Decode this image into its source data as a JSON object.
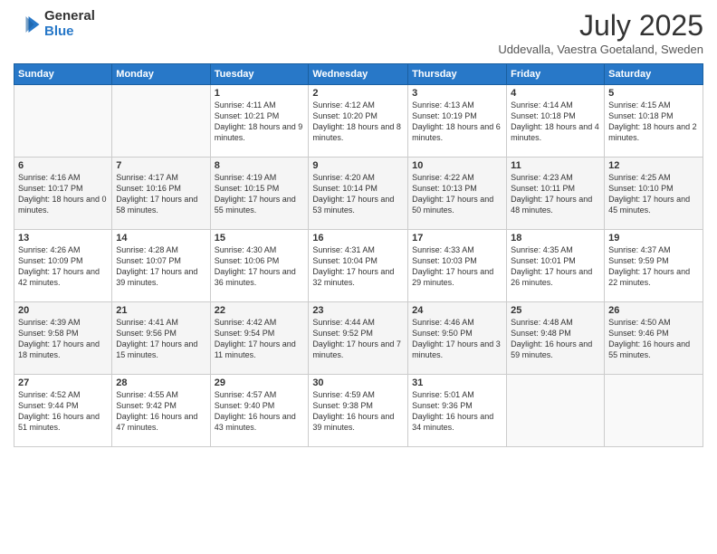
{
  "logo": {
    "general": "General",
    "blue": "Blue"
  },
  "title": "July 2025",
  "location": "Uddevalla, Vaestra Goetaland, Sweden",
  "weekdays": [
    "Sunday",
    "Monday",
    "Tuesday",
    "Wednesday",
    "Thursday",
    "Friday",
    "Saturday"
  ],
  "weeks": [
    [
      {
        "day": "",
        "info": ""
      },
      {
        "day": "",
        "info": ""
      },
      {
        "day": "1",
        "info": "Sunrise: 4:11 AM\nSunset: 10:21 PM\nDaylight: 18 hours and 9 minutes."
      },
      {
        "day": "2",
        "info": "Sunrise: 4:12 AM\nSunset: 10:20 PM\nDaylight: 18 hours and 8 minutes."
      },
      {
        "day": "3",
        "info": "Sunrise: 4:13 AM\nSunset: 10:19 PM\nDaylight: 18 hours and 6 minutes."
      },
      {
        "day": "4",
        "info": "Sunrise: 4:14 AM\nSunset: 10:18 PM\nDaylight: 18 hours and 4 minutes."
      },
      {
        "day": "5",
        "info": "Sunrise: 4:15 AM\nSunset: 10:18 PM\nDaylight: 18 hours and 2 minutes."
      }
    ],
    [
      {
        "day": "6",
        "info": "Sunrise: 4:16 AM\nSunset: 10:17 PM\nDaylight: 18 hours and 0 minutes."
      },
      {
        "day": "7",
        "info": "Sunrise: 4:17 AM\nSunset: 10:16 PM\nDaylight: 17 hours and 58 minutes."
      },
      {
        "day": "8",
        "info": "Sunrise: 4:19 AM\nSunset: 10:15 PM\nDaylight: 17 hours and 55 minutes."
      },
      {
        "day": "9",
        "info": "Sunrise: 4:20 AM\nSunset: 10:14 PM\nDaylight: 17 hours and 53 minutes."
      },
      {
        "day": "10",
        "info": "Sunrise: 4:22 AM\nSunset: 10:13 PM\nDaylight: 17 hours and 50 minutes."
      },
      {
        "day": "11",
        "info": "Sunrise: 4:23 AM\nSunset: 10:11 PM\nDaylight: 17 hours and 48 minutes."
      },
      {
        "day": "12",
        "info": "Sunrise: 4:25 AM\nSunset: 10:10 PM\nDaylight: 17 hours and 45 minutes."
      }
    ],
    [
      {
        "day": "13",
        "info": "Sunrise: 4:26 AM\nSunset: 10:09 PM\nDaylight: 17 hours and 42 minutes."
      },
      {
        "day": "14",
        "info": "Sunrise: 4:28 AM\nSunset: 10:07 PM\nDaylight: 17 hours and 39 minutes."
      },
      {
        "day": "15",
        "info": "Sunrise: 4:30 AM\nSunset: 10:06 PM\nDaylight: 17 hours and 36 minutes."
      },
      {
        "day": "16",
        "info": "Sunrise: 4:31 AM\nSunset: 10:04 PM\nDaylight: 17 hours and 32 minutes."
      },
      {
        "day": "17",
        "info": "Sunrise: 4:33 AM\nSunset: 10:03 PM\nDaylight: 17 hours and 29 minutes."
      },
      {
        "day": "18",
        "info": "Sunrise: 4:35 AM\nSunset: 10:01 PM\nDaylight: 17 hours and 26 minutes."
      },
      {
        "day": "19",
        "info": "Sunrise: 4:37 AM\nSunset: 9:59 PM\nDaylight: 17 hours and 22 minutes."
      }
    ],
    [
      {
        "day": "20",
        "info": "Sunrise: 4:39 AM\nSunset: 9:58 PM\nDaylight: 17 hours and 18 minutes."
      },
      {
        "day": "21",
        "info": "Sunrise: 4:41 AM\nSunset: 9:56 PM\nDaylight: 17 hours and 15 minutes."
      },
      {
        "day": "22",
        "info": "Sunrise: 4:42 AM\nSunset: 9:54 PM\nDaylight: 17 hours and 11 minutes."
      },
      {
        "day": "23",
        "info": "Sunrise: 4:44 AM\nSunset: 9:52 PM\nDaylight: 17 hours and 7 minutes."
      },
      {
        "day": "24",
        "info": "Sunrise: 4:46 AM\nSunset: 9:50 PM\nDaylight: 17 hours and 3 minutes."
      },
      {
        "day": "25",
        "info": "Sunrise: 4:48 AM\nSunset: 9:48 PM\nDaylight: 16 hours and 59 minutes."
      },
      {
        "day": "26",
        "info": "Sunrise: 4:50 AM\nSunset: 9:46 PM\nDaylight: 16 hours and 55 minutes."
      }
    ],
    [
      {
        "day": "27",
        "info": "Sunrise: 4:52 AM\nSunset: 9:44 PM\nDaylight: 16 hours and 51 minutes."
      },
      {
        "day": "28",
        "info": "Sunrise: 4:55 AM\nSunset: 9:42 PM\nDaylight: 16 hours and 47 minutes."
      },
      {
        "day": "29",
        "info": "Sunrise: 4:57 AM\nSunset: 9:40 PM\nDaylight: 16 hours and 43 minutes."
      },
      {
        "day": "30",
        "info": "Sunrise: 4:59 AM\nSunset: 9:38 PM\nDaylight: 16 hours and 39 minutes."
      },
      {
        "day": "31",
        "info": "Sunrise: 5:01 AM\nSunset: 9:36 PM\nDaylight: 16 hours and 34 minutes."
      },
      {
        "day": "",
        "info": ""
      },
      {
        "day": "",
        "info": ""
      }
    ]
  ]
}
